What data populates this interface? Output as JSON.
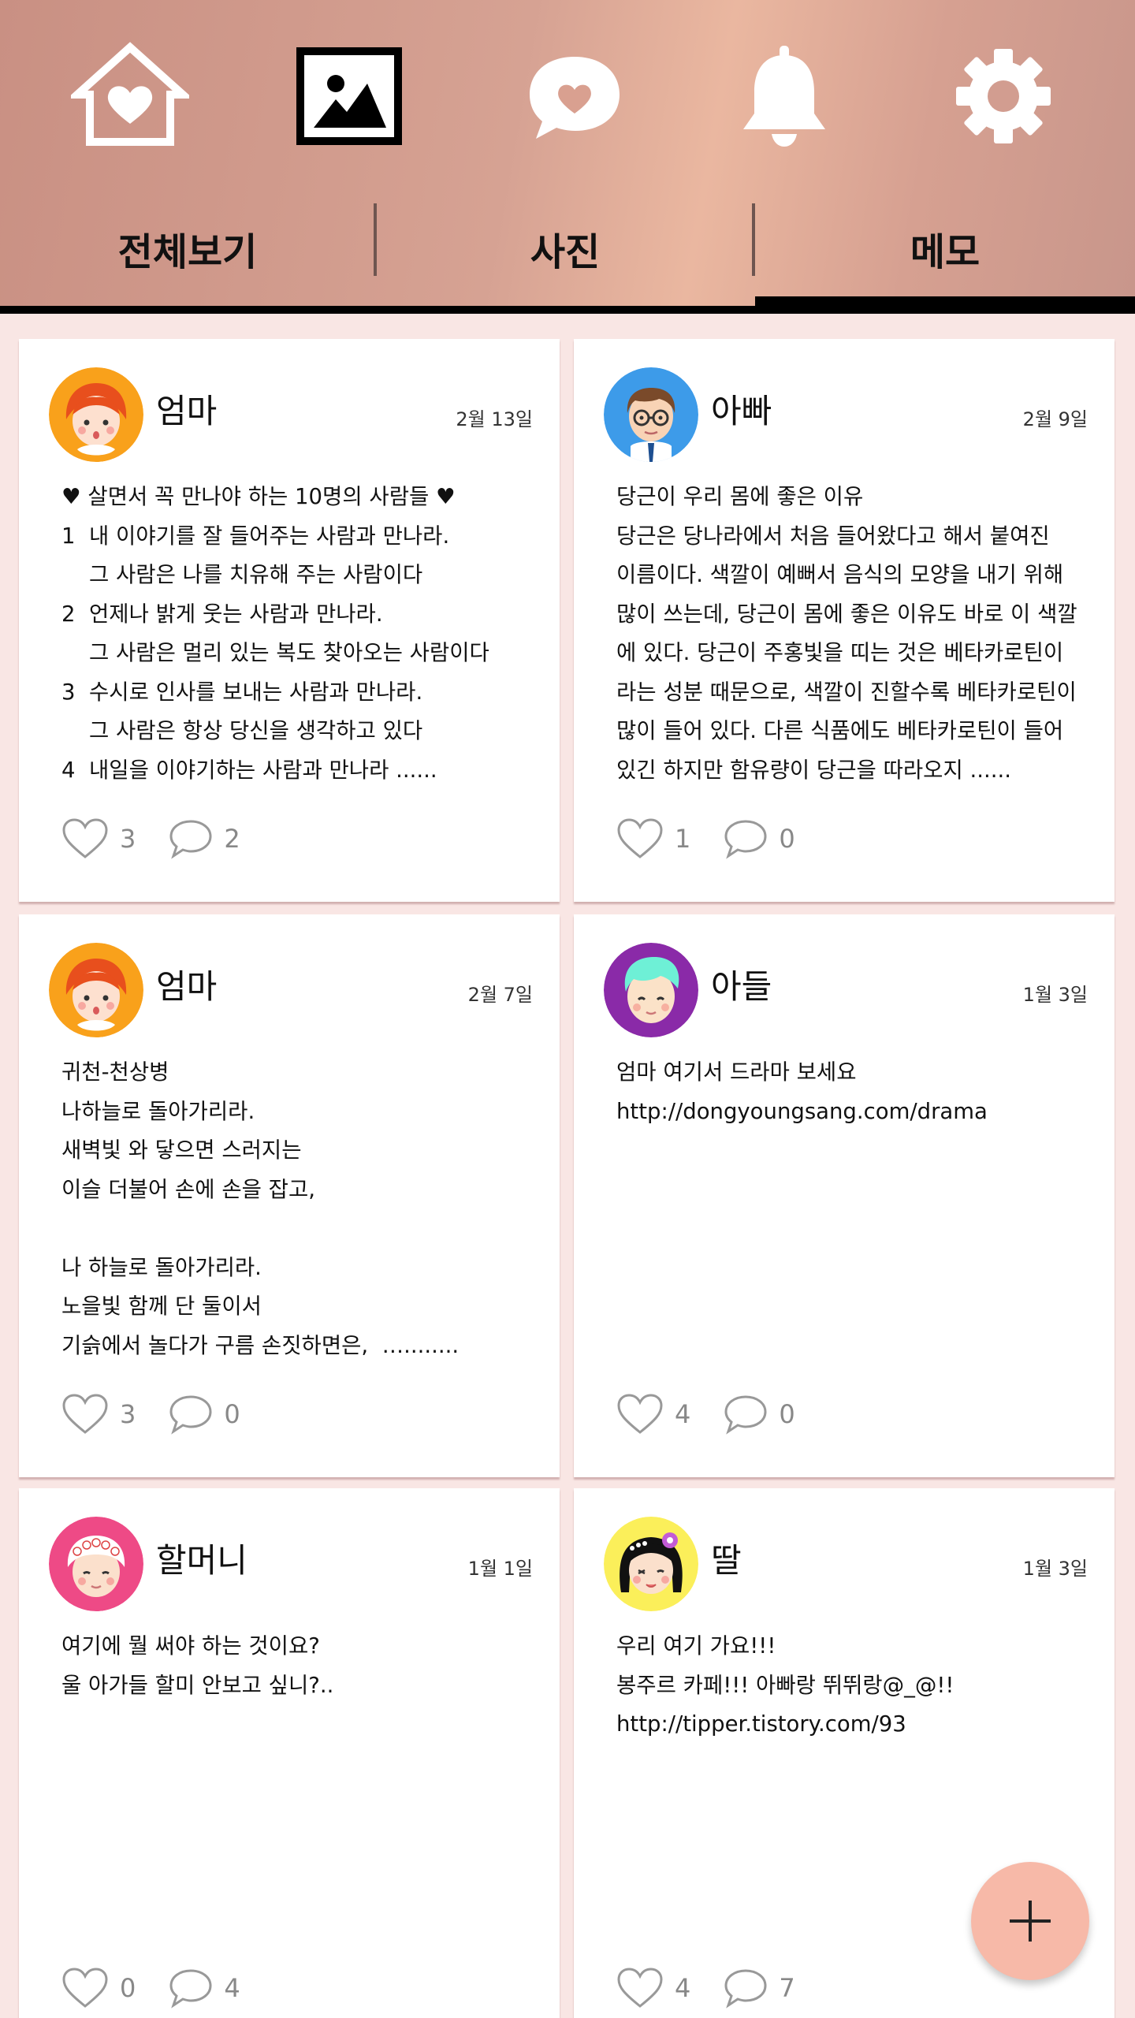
{
  "nav": {
    "icons": [
      "home-heart-icon",
      "image-icon",
      "chat-heart-icon",
      "bell-icon",
      "gear-icon"
    ],
    "active_icon": "image-icon"
  },
  "tabs": [
    {
      "label": "전체보기"
    },
    {
      "label": "사진"
    },
    {
      "label": "메모"
    }
  ],
  "active_tab": "메모",
  "colors": {
    "header_gradient_start": "#c99083",
    "header_gradient_mid": "#eab7a0",
    "page_background": "#f9e6e4",
    "fab": "#f7b9a8",
    "like_icon": "#9a9a9a",
    "count_text": "#888888"
  },
  "posts": [
    {
      "author": "엄마",
      "avatar": "mom-avatar",
      "date": "2월 13일",
      "body": "♥ 살면서 꼭 만나야 하는 10명의 사람들 ♥\n1  내 이야기를 잘 들어주는 사람과 만나라.\n    그 사람은 나를 치유해 주는 사람이다\n2  언제나 밝게 웃는 사람과 만나라.\n    그 사람은 멀리 있는 복도 찾아오는 사람이다\n3  수시로 인사를 보내는 사람과 만나라.\n    그 사람은 항상 당신을 생각하고 있다\n4  내일을 이야기하는 사람과 만나라 ......",
      "likes": "3",
      "comments": "2"
    },
    {
      "author": "아빠",
      "avatar": "dad-avatar",
      "date": "2월 9일",
      "body": "당근이 우리 몸에 좋은 이유\n당근은 당나라에서 처음 들어왔다고 해서 붙여진\n이름이다. 색깔이 예뻐서 음식의 모양을 내기 위해\n많이 쓰는데, 당근이 몸에 좋은 이유도 바로 이 색깔\n에 있다. 당근이 주홍빛을 띠는 것은 베타카로틴이\n라는 성분 때문으로, 색깔이 진할수록 베타카로틴이\n많이 들어 있다. 다른 식품에도 베타카로틴이 들어\n있긴 하지만 함유량이 당근을 따라오지 ......",
      "likes": "1",
      "comments": "0"
    },
    {
      "author": "엄마",
      "avatar": "mom-avatar",
      "date": "2월 7일",
      "body": "귀천-천상병\n나하늘로 돌아가리라.\n새벽빛 와 닿으면 스러지는\n이슬 더불어 손에 손을 잡고,\n\n나 하늘로 돌아가리라.\n노을빛 함께 단 둘이서\n기슭에서 놀다가 구름 손짓하면은,  …........",
      "likes": "3",
      "comments": "0"
    },
    {
      "author": "아들",
      "avatar": "son-avatar",
      "date": "1월 3일",
      "body": "엄마 여기서 드라마 보세요\nhttp://dongyoungsang.com/drama",
      "likes": "4",
      "comments": "0"
    },
    {
      "author": "할머니",
      "avatar": "grandma-avatar",
      "date": "1월 1일",
      "body": "여기에 뭘 써야 하는 것이요?\n울 아가들 할미 안보고 싶니?..",
      "likes": "0",
      "comments": "4"
    },
    {
      "author": "딸",
      "avatar": "daughter-avatar",
      "date": "1월 3일",
      "body": "우리 여기 가요!!!\n봉주르 카페!!! 아빠랑 뛰뛰랑@_@!!\nhttp://tipper.tistory.com/93",
      "likes": "4",
      "comments": "7"
    }
  ],
  "fab": {
    "icon": "plus-icon"
  }
}
